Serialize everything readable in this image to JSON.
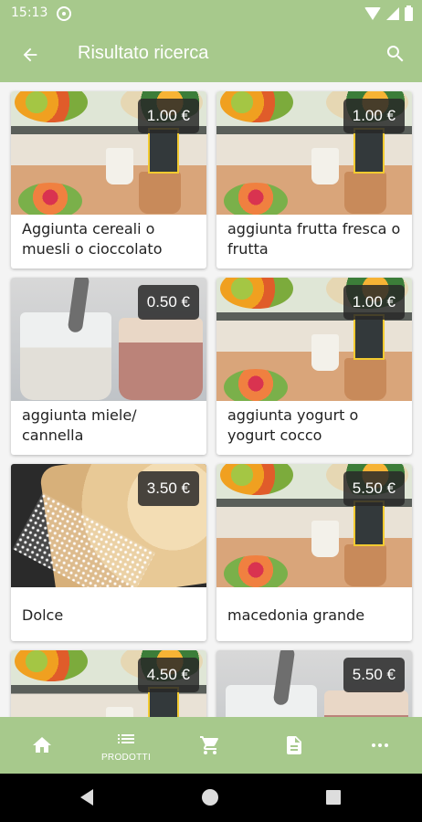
{
  "statusbar": {
    "time": "15:13"
  },
  "appbar": {
    "title": "Risultato ricerca"
  },
  "products": [
    {
      "name": "Aggiunta cereali o muesli o cioccolato",
      "price": "1.00 €"
    },
    {
      "name": "aggiunta frutta fresca o frutta",
      "price": "1.00 €"
    },
    {
      "name": "aggiunta miele/ cannella",
      "price": "0.50 €"
    },
    {
      "name": "aggiunta yogurt o yogurt cocco",
      "price": "1.00 €"
    },
    {
      "name": "Dolce",
      "price": "3.50 €"
    },
    {
      "name": "macedonia grande",
      "price": "5.50 €"
    },
    {
      "name": "",
      "price": "4.50 €"
    },
    {
      "name": "",
      "price": "5.50 €"
    }
  ],
  "bottom_nav": {
    "active": "prodotti",
    "prodotti_label": "PRODOTTI"
  },
  "colors": {
    "accent": "#a7c98c",
    "price_badge": "#282828"
  },
  "icons": [
    "back-arrow-icon",
    "search-icon",
    "home-icon",
    "list-icon",
    "cart-icon",
    "document-icon",
    "more-icon"
  ]
}
